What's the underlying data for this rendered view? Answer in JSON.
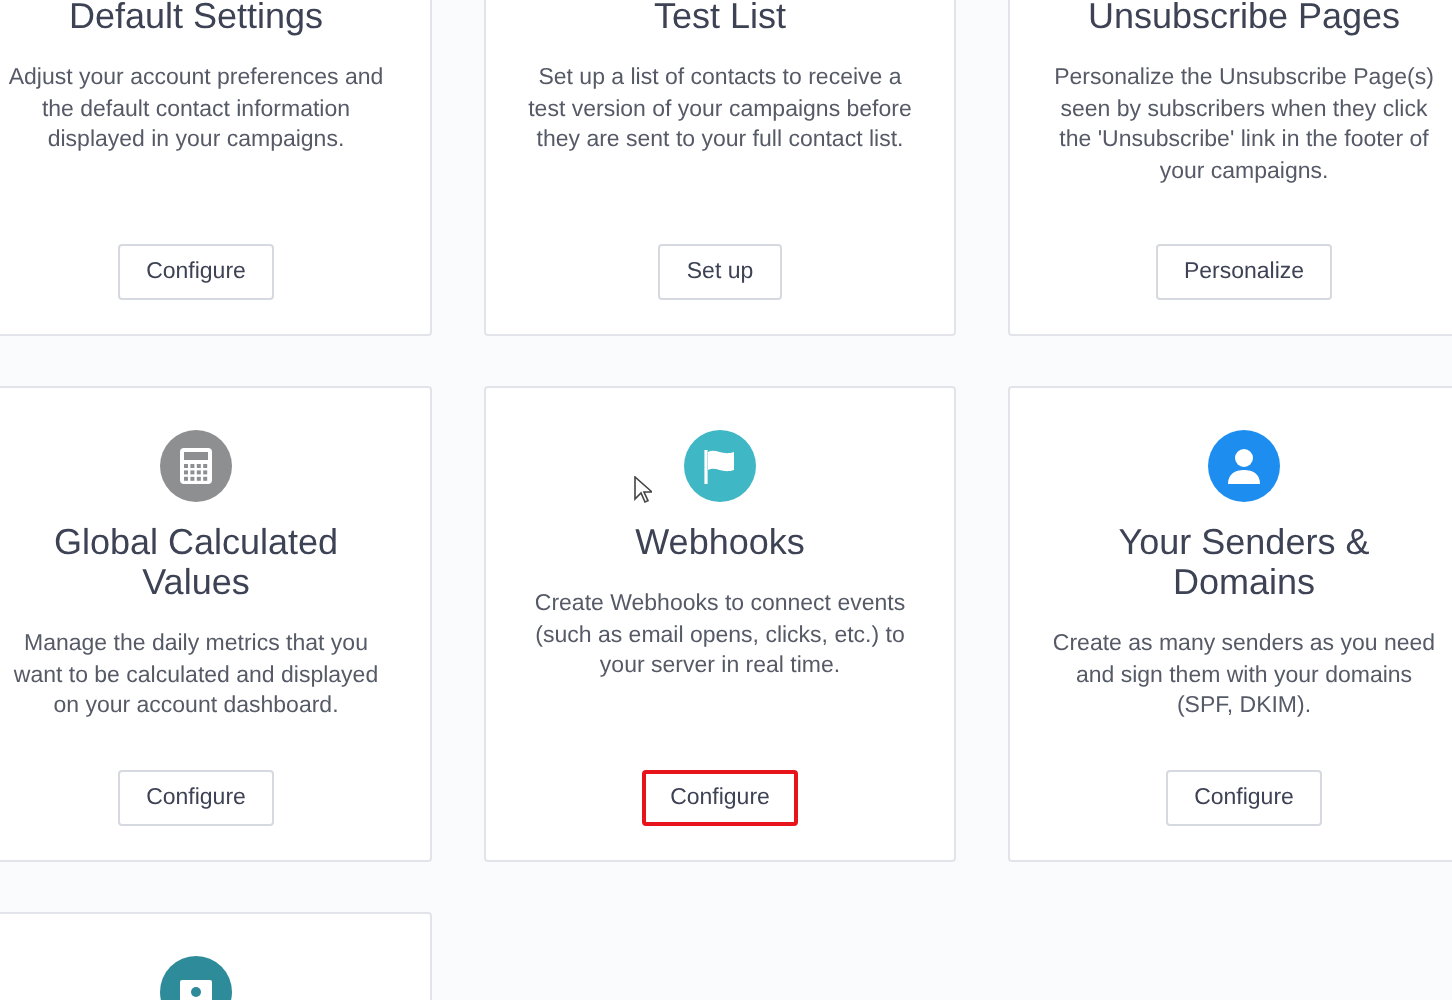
{
  "cards": [
    {
      "title": "Default Settings",
      "description": "Adjust your account preferences and the default contact information displayed in your campaigns.",
      "button": {
        "label": "Configure",
        "highlighted": false
      }
    },
    {
      "title": "Test List",
      "description": "Set up a list of contacts to receive a test version of your campaigns before they are sent to your full contact list.",
      "button": {
        "label": "Set up",
        "highlighted": false
      }
    },
    {
      "title": "Unsubscribe Pages",
      "description": "Personalize the Unsubscribe Page(s) seen by subscribers when they click the 'Unsubscribe' link in the footer of your campaigns.",
      "button": {
        "label": "Personalize",
        "highlighted": false
      }
    },
    {
      "title": "Global Calculated Values",
      "description": "Manage the daily metrics that you want to be calculated and displayed on your account dashboard.",
      "button": {
        "label": "Configure",
        "highlighted": false
      }
    },
    {
      "title": "Webhooks",
      "description": "Create Webhooks to connect events (such as email opens, clicks, etc.) to your server in real time.",
      "button": {
        "label": "Configure",
        "highlighted": true
      }
    },
    {
      "title": "Your Senders & Domains",
      "description": "Create as many senders as you need and sign them with your domains (SPF, DKIM).",
      "button": {
        "label": "Configure",
        "highlighted": false
      }
    },
    {
      "kind": "stub"
    }
  ]
}
